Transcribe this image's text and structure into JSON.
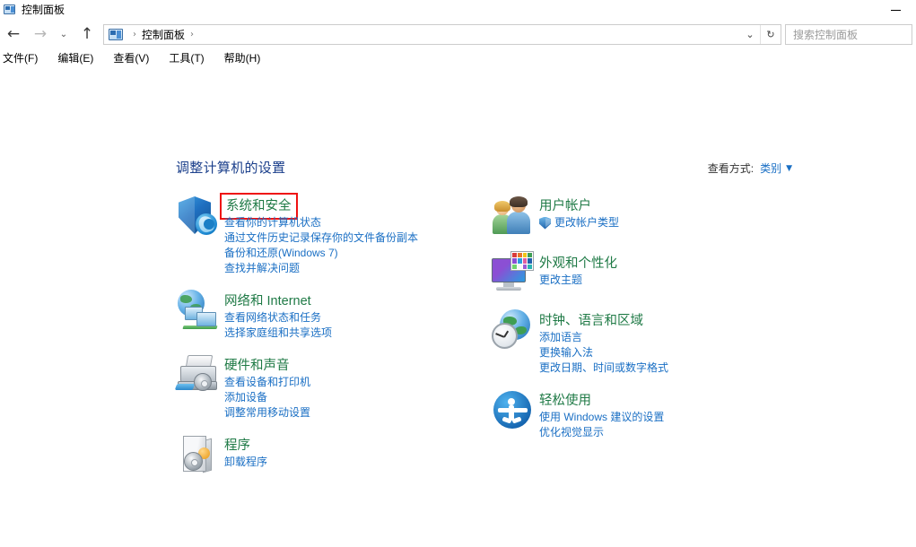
{
  "window": {
    "title": "控制面板",
    "title_icon": "control-panel-icon",
    "minimize_label": "—"
  },
  "nav": {
    "back_icon": "arrow-left-icon",
    "forward_icon": "arrow-right-icon",
    "recent_icon": "chevron-down-icon",
    "up_icon": "arrow-up-icon",
    "breadcrumb_icon": "control-panel-icon",
    "breadcrumb": [
      "控制面板"
    ],
    "separator": "›",
    "dropdown_icon": "chevron-down-icon",
    "refresh_icon": "refresh-icon"
  },
  "search": {
    "placeholder": "搜索控制面板"
  },
  "menubar": {
    "items": [
      {
        "label": "文件(F)"
      },
      {
        "label": "编辑(E)"
      },
      {
        "label": "查看(V)"
      },
      {
        "label": "工具(T)"
      },
      {
        "label": "帮助(H)"
      }
    ]
  },
  "main": {
    "heading": "调整计算机的设置",
    "view_by": {
      "label": "查看方式:",
      "value": "类别",
      "chevron": "▼"
    },
    "left_column": [
      {
        "id": "system-and-security",
        "icon": "shield-icon",
        "title": "系统和安全",
        "highlighted": true,
        "links": [
          {
            "text": "查看你的计算机状态"
          },
          {
            "text": "通过文件历史记录保存你的文件备份副本"
          },
          {
            "text": "备份和还原(Windows 7)"
          },
          {
            "text": "查找并解决问题"
          }
        ]
      },
      {
        "id": "network-and-internet",
        "icon": "network-globe-icon",
        "title": "网络和 Internet",
        "highlighted": false,
        "links": [
          {
            "text": "查看网络状态和任务"
          },
          {
            "text": "选择家庭组和共享选项"
          }
        ]
      },
      {
        "id": "hardware-and-sound",
        "icon": "printer-icon",
        "title": "硬件和声音",
        "highlighted": false,
        "links": [
          {
            "text": "查看设备和打印机"
          },
          {
            "text": "添加设备"
          },
          {
            "text": "调整常用移动设置"
          }
        ]
      },
      {
        "id": "programs",
        "icon": "programs-box-icon",
        "title": "程序",
        "highlighted": false,
        "links": [
          {
            "text": "卸载程序"
          }
        ]
      }
    ],
    "right_column": [
      {
        "id": "user-accounts",
        "icon": "users-icon",
        "title": "用户帐户",
        "highlighted": false,
        "links": [
          {
            "text": "更改帐户类型",
            "shield": true
          }
        ]
      },
      {
        "id": "appearance-and-personalization",
        "icon": "monitor-palette-icon",
        "title": "外观和个性化",
        "highlighted": false,
        "links": [
          {
            "text": "更改主题"
          }
        ]
      },
      {
        "id": "clock-language-and-region",
        "icon": "clock-globe-icon",
        "title": "时钟、语言和区域",
        "highlighted": false,
        "links": [
          {
            "text": "添加语言"
          },
          {
            "text": "更换输入法"
          },
          {
            "text": "更改日期、时间或数字格式"
          }
        ]
      },
      {
        "id": "ease-of-access",
        "icon": "ease-of-access-icon",
        "title": "轻松使用",
        "highlighted": false,
        "links": [
          {
            "text": "使用 Windows 建议的设置"
          },
          {
            "text": "优化视觉显示"
          }
        ]
      }
    ]
  },
  "colors": {
    "category_title": "#1f7a46",
    "link": "#1a6fc4",
    "heading": "#1b3f8b",
    "highlight_box": "#ef1111",
    "window_bg": "#ffffff"
  },
  "palette_swatches": [
    "#d93b3b",
    "#e8762a",
    "#f0c419",
    "#3f9e53",
    "#8b4fd4",
    "#2a9de0",
    "#e05fa0",
    "#1f5fae",
    "#6fd36f",
    "#f7f7f7",
    "#9b5bd4",
    "#2bb3b3"
  ]
}
